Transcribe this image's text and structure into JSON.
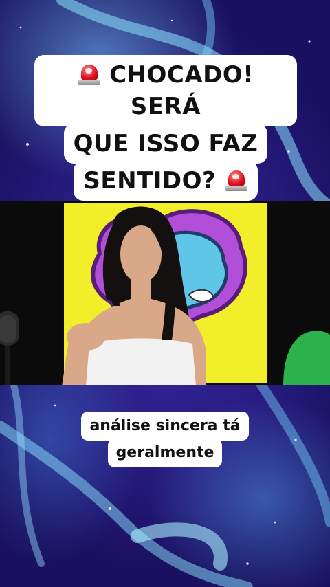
{
  "top_caption": {
    "line1": "CHOCADO! SERÁ",
    "line2": "QUE ISSO FAZ",
    "line3": "SENTIDO?",
    "emoji": "police-light-icon"
  },
  "bottom_caption": {
    "line1": "análise sincera tá",
    "line2": "geralmente"
  },
  "colors": {
    "background": "#2a1d8a",
    "caption_bg": "#ffffff",
    "caption_text": "#111111",
    "poster_yellow": "#f3ee2a",
    "siren_red": "#e01020"
  }
}
